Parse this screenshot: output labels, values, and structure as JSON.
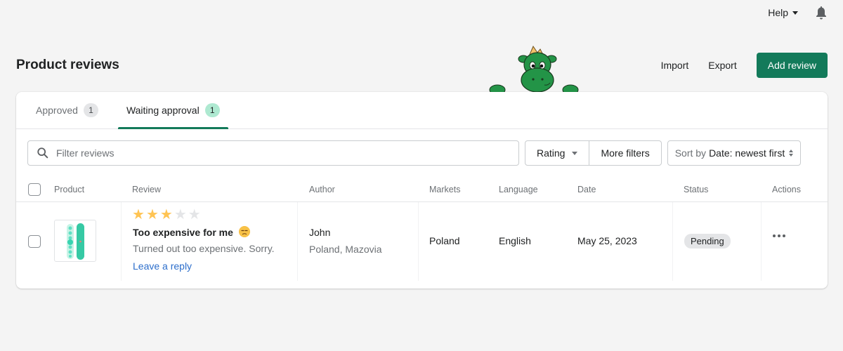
{
  "topbar": {
    "help_label": "Help",
    "bell_icon": "bell-icon"
  },
  "header": {
    "title": "Product reviews",
    "import_label": "Import",
    "export_label": "Export",
    "add_review_label": "Add review",
    "mascot": "green-dragon-mascot"
  },
  "colors": {
    "primary": "#137a5a",
    "link": "#2c6ecb",
    "star_filled": "#ffc453",
    "star_empty": "#e4e5e7",
    "active_count_bg": "#aee9d1"
  },
  "tabs": [
    {
      "label": "Approved",
      "count": "1",
      "active": false
    },
    {
      "label": "Waiting approval",
      "count": "1",
      "active": true
    }
  ],
  "filters": {
    "search_placeholder": "Filter reviews",
    "search_value": "",
    "rating_label": "Rating",
    "more_filters_label": "More filters",
    "sort_prefix": "Sort by",
    "sort_value": "Date: newest first"
  },
  "table": {
    "columns": [
      "Product",
      "Review",
      "Author",
      "Markets",
      "Language",
      "Date",
      "Status",
      "Actions"
    ],
    "rows": [
      {
        "product_image": "snowboard-thumbnail",
        "rating": 3,
        "rating_max": 5,
        "review_title": "Too expensive for me",
        "review_emoji": "😒",
        "review_body": "Turned out too expensive. Sorry.",
        "reply_label": "Leave a reply",
        "author_name": "John",
        "author_location": "Poland, Mazovia",
        "market": "Poland",
        "language": "English",
        "date": "May 25, 2023",
        "status": "Pending"
      }
    ]
  }
}
